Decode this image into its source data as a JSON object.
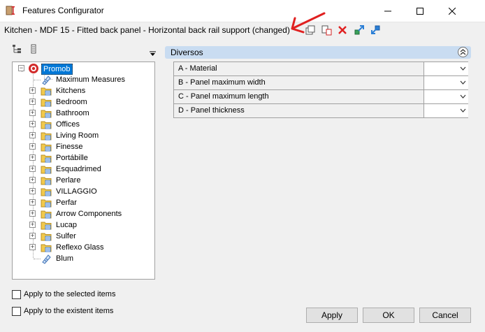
{
  "window": {
    "title": "Features Configurator",
    "controls": {
      "minimize": "minimize",
      "maximize": "maximize",
      "close": "close"
    }
  },
  "context": {
    "path": "Kitchen - MDF 15 - Fitted back panel - Horizontal back rail support (changed)"
  },
  "toolbar_icons": [
    "copy-icon",
    "paste-icon",
    "delete-icon",
    "export-icon",
    "import-icon"
  ],
  "tree": {
    "root": "Promob",
    "items": [
      {
        "label": "Maximum Measures",
        "expandable": false,
        "icon": "measure-icon"
      },
      {
        "label": "Kitchens",
        "expandable": true,
        "icon": "folder-icon"
      },
      {
        "label": "Bedroom",
        "expandable": true,
        "icon": "folder-icon"
      },
      {
        "label": "Bathroom",
        "expandable": true,
        "icon": "folder-icon"
      },
      {
        "label": "Offices",
        "expandable": true,
        "icon": "folder-icon"
      },
      {
        "label": "Living Room",
        "expandable": true,
        "icon": "folder-icon"
      },
      {
        "label": "Finesse",
        "expandable": true,
        "icon": "folder-icon"
      },
      {
        "label": "Portábille",
        "expandable": true,
        "icon": "folder-icon"
      },
      {
        "label": "Esquadrimed",
        "expandable": true,
        "icon": "folder-icon"
      },
      {
        "label": "Perlare",
        "expandable": true,
        "icon": "folder-icon"
      },
      {
        "label": "VILLAGGIO",
        "expandable": true,
        "icon": "folder-icon"
      },
      {
        "label": "Perfar",
        "expandable": true,
        "icon": "folder-icon"
      },
      {
        "label": "Arrow Components",
        "expandable": true,
        "icon": "folder-icon"
      },
      {
        "label": "Lucap",
        "expandable": true,
        "icon": "folder-icon"
      },
      {
        "label": "Sulfer",
        "expandable": true,
        "icon": "folder-icon"
      },
      {
        "label": "Reflexo Glass",
        "expandable": true,
        "icon": "folder-icon"
      },
      {
        "label": "Blum",
        "expandable": false,
        "icon": "measure-icon"
      }
    ]
  },
  "properties": {
    "group_title": "Diversos",
    "rows": [
      {
        "label": "A - Material",
        "value": ""
      },
      {
        "label": "B - Panel maximum width",
        "value": ""
      },
      {
        "label": "C - Panel maximum length",
        "value": ""
      },
      {
        "label": "D - Panel thickness",
        "value": ""
      }
    ]
  },
  "options": {
    "apply_selected": "Apply to the selected items",
    "apply_existent": "Apply to the existent items"
  },
  "buttons": {
    "apply": "Apply",
    "ok": "OK",
    "cancel": "Cancel"
  },
  "colors": {
    "selection": "#0078d7",
    "group_header": "#c9dcf1",
    "annotation_arrow": "#e02020",
    "folder": "#f2c94c"
  }
}
